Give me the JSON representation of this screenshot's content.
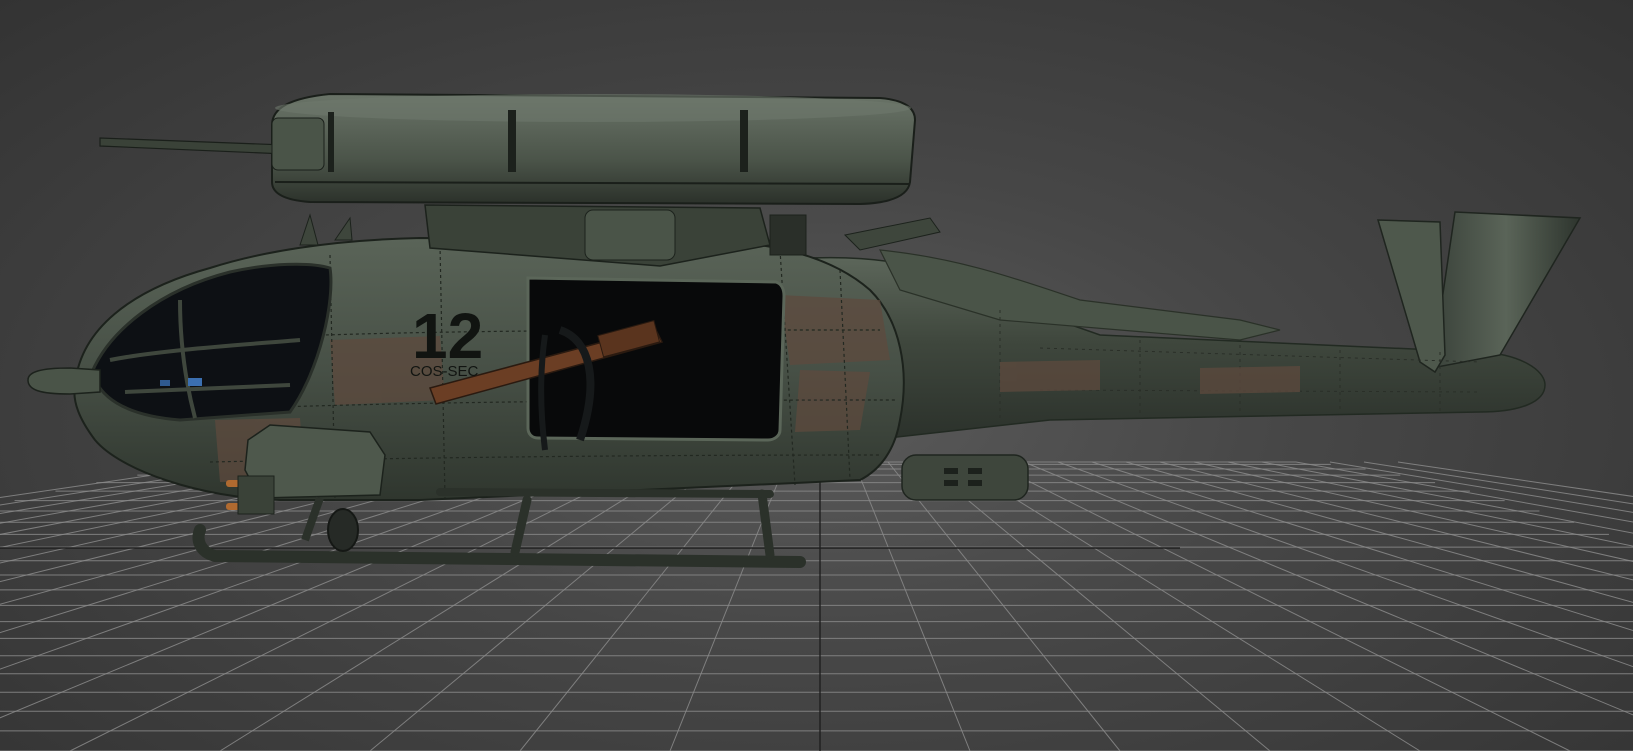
{
  "viewport": {
    "background": "#474747",
    "grid_color": "#8a8a8a",
    "grid_axis_color": "#1e1e1e"
  },
  "model": {
    "hull_number": "12",
    "hull_text": "COS-SEC",
    "paint_color": "#4a5448",
    "panel_rust_color": "#5e4a3e",
    "gun_color": "#6b3e24"
  }
}
